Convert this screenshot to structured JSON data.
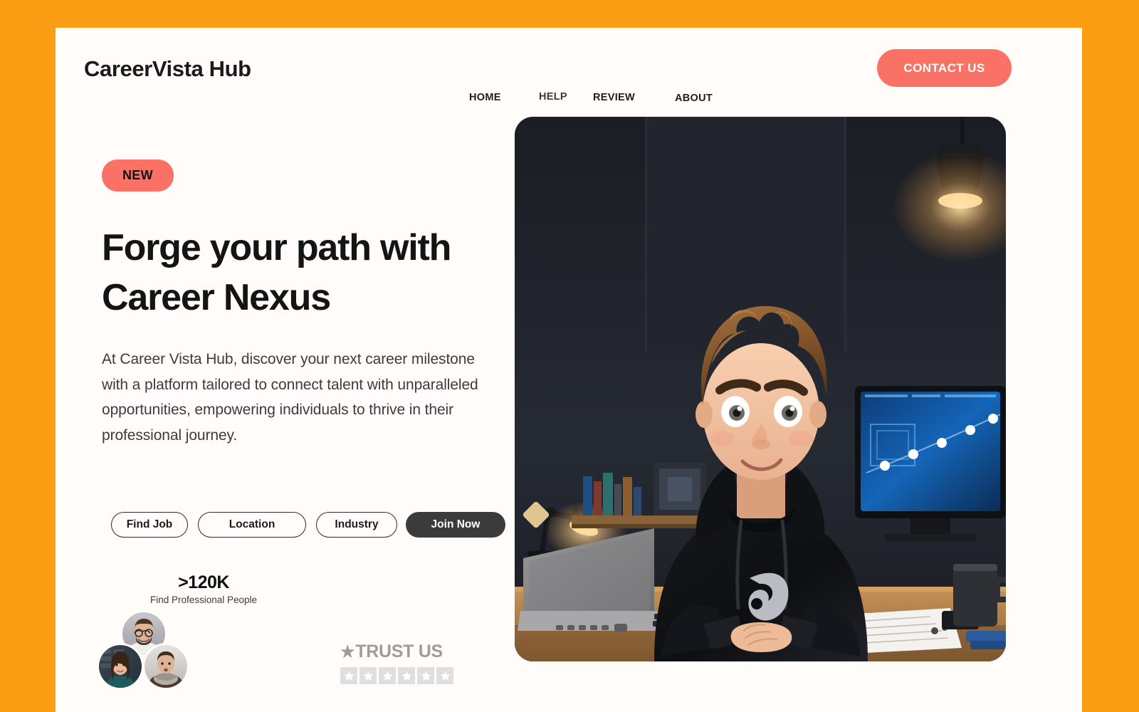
{
  "theme": {
    "page_background": "#FB9E14",
    "card_background": "#FFFCF9",
    "accent_coral": "#FA7265",
    "dark_button": "#3B3B3B",
    "text_dark": "#141414",
    "text_muted": "#3C3C3C",
    "trust_gray": "#9D9D9D"
  },
  "header": {
    "logo": "CareerVista Hub",
    "nav": [
      {
        "label": "HOME"
      },
      {
        "label": "HELP"
      },
      {
        "label": "REVIEW"
      },
      {
        "label": "ABOUT"
      }
    ],
    "cta": {
      "label": "CONTACT US"
    }
  },
  "hero": {
    "badge": "NEW",
    "headline": "Forge your path with Career Nexus",
    "subtext": "At Career Vista Hub, discover your next career milestone with a platform tailored to connect talent with unparalleled opportunities, empowering individuals to thrive in their professional journey.",
    "filters": [
      {
        "label": "Find Job",
        "style": "outline"
      },
      {
        "label": "Location",
        "style": "outline"
      },
      {
        "label": "Industry",
        "style": "outline"
      },
      {
        "label": "Join Now",
        "style": "solid"
      }
    ],
    "stats": {
      "number": ">120K",
      "label": "Find Professional People"
    },
    "avatars": [
      {
        "name": "avatar-man-glasses"
      },
      {
        "name": "avatar-woman"
      },
      {
        "name": "avatar-man-scarf"
      }
    ],
    "trust": {
      "title": "TRUST US",
      "lead_star": "★",
      "star_count": 6
    },
    "image": {
      "alt": "3D cartoon illustration of a young man in a black hoodie sitting at a desk at night with a laptop, desk lamp, monitor and coffee mug",
      "icon": "hero-illustration"
    }
  }
}
